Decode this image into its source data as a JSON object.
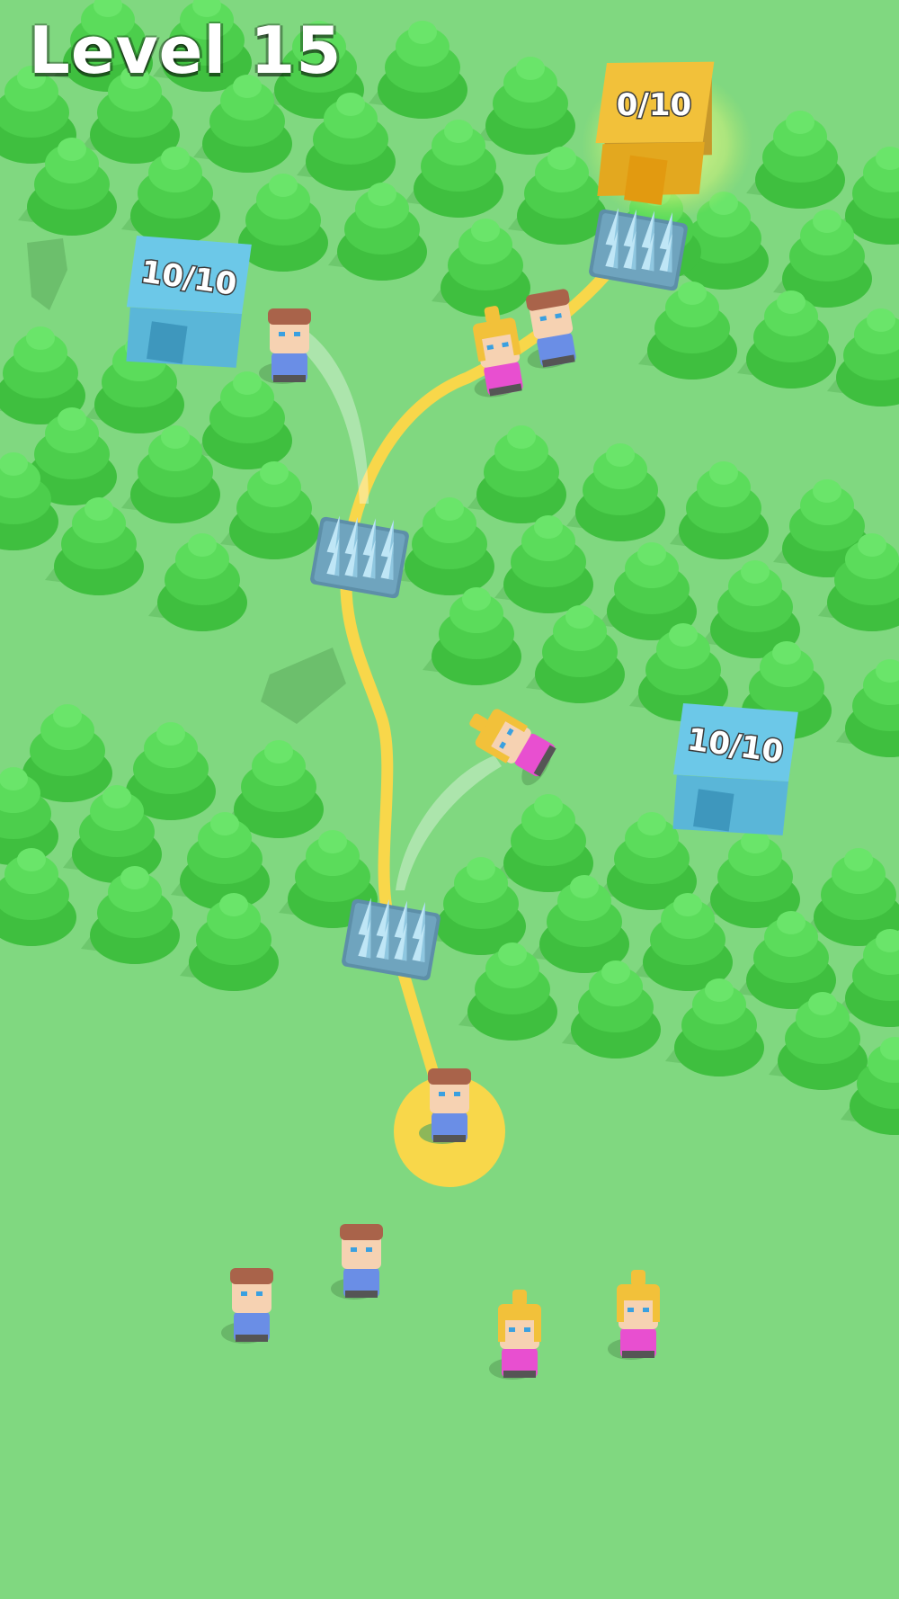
{
  "hud": {
    "level_label": "Level 15"
  },
  "houses": [
    {
      "id": "goal",
      "counter": "0/10",
      "color": "#f2c13a",
      "state": "target"
    },
    {
      "id": "blue-top-left",
      "counter": "10/10",
      "color": "#6cc8e8",
      "state": "full"
    },
    {
      "id": "blue-right",
      "counter": "10/10",
      "color": "#6cc8e8",
      "state": "full"
    }
  ],
  "traps": [
    {
      "id": "spike-trap-top",
      "icon": "spike-trap-icon"
    },
    {
      "id": "spike-trap-middle",
      "icon": "spike-trap-icon"
    },
    {
      "id": "spike-trap-bottom",
      "icon": "spike-trap-icon"
    }
  ],
  "characters": [
    {
      "id": "selected-boy",
      "type": "boy",
      "state": "selected"
    },
    {
      "id": "waiting-boy-1",
      "type": "boy",
      "state": "waiting"
    },
    {
      "id": "waiting-boy-2",
      "type": "boy",
      "state": "waiting"
    },
    {
      "id": "waiting-girl-1",
      "type": "girl",
      "state": "waiting"
    },
    {
      "id": "waiting-girl-2",
      "type": "girl",
      "state": "waiting"
    },
    {
      "id": "walking-girl",
      "type": "girl",
      "state": "walking"
    },
    {
      "id": "walking-boy",
      "type": "boy",
      "state": "walking"
    },
    {
      "id": "flying-boy",
      "type": "boy",
      "state": "knocked-back"
    },
    {
      "id": "flying-girl",
      "type": "girl",
      "state": "knocked-back"
    }
  ],
  "colors": {
    "ground": "#80d880",
    "path": "#f8d74a",
    "tree": "#4fd04f",
    "house_goal": "#f2c13a",
    "house_blue": "#6cc8e8",
    "boy_shirt": "#6a8ee6",
    "girl_shirt": "#e84fd0"
  }
}
